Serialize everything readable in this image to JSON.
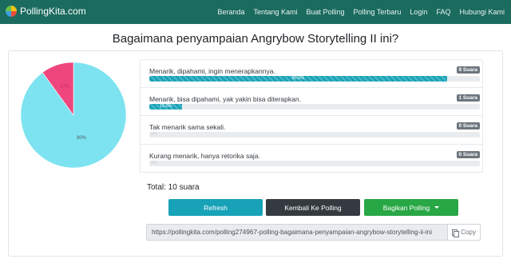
{
  "nav": {
    "brand": "PollingKita.com",
    "items": [
      "Beranda",
      "Tentang Kami",
      "Buat Polling",
      "Polling Terbaru",
      "Login",
      "FAQ",
      "Hubungi Kami"
    ]
  },
  "poll": {
    "title": "Bagaimana penyampaian Angrybow Storytelling II ini?",
    "options": [
      {
        "label": "Menarik, dipahami, ingin menerapkannya.",
        "votes": "9 Suara",
        "percent": 90,
        "percent_label": "90.0%"
      },
      {
        "label": "Menarik, bisa dipahami, yak yakin bisa diterapkan.",
        "votes": "1 Suara",
        "percent": 10,
        "percent_label": "10.0%"
      },
      {
        "label": "Tak menarik sama sekali.",
        "votes": "0 Suara",
        "percent": 0,
        "percent_label": "0%"
      },
      {
        "label": "Kurang menarik, hanya retorika saja.",
        "votes": "0 Suara",
        "percent": 0,
        "percent_label": "0%"
      }
    ],
    "total": "Total: 10 suara",
    "buttons": {
      "refresh": "Refresh",
      "back": "Kembali Ke Polling",
      "share": "Bagikan Polling"
    },
    "url": "https://pollingkita.com/polling274967-polling-bagaimana-penyampaian-angrybow-storytelling-ii-ini",
    "copy": "Copy"
  },
  "chart_data": {
    "type": "pie",
    "slices": [
      {
        "label": "90%",
        "value": 90,
        "color": "#7de3f0"
      },
      {
        "label": "10%",
        "value": 10,
        "color": "#f0467e"
      }
    ]
  }
}
